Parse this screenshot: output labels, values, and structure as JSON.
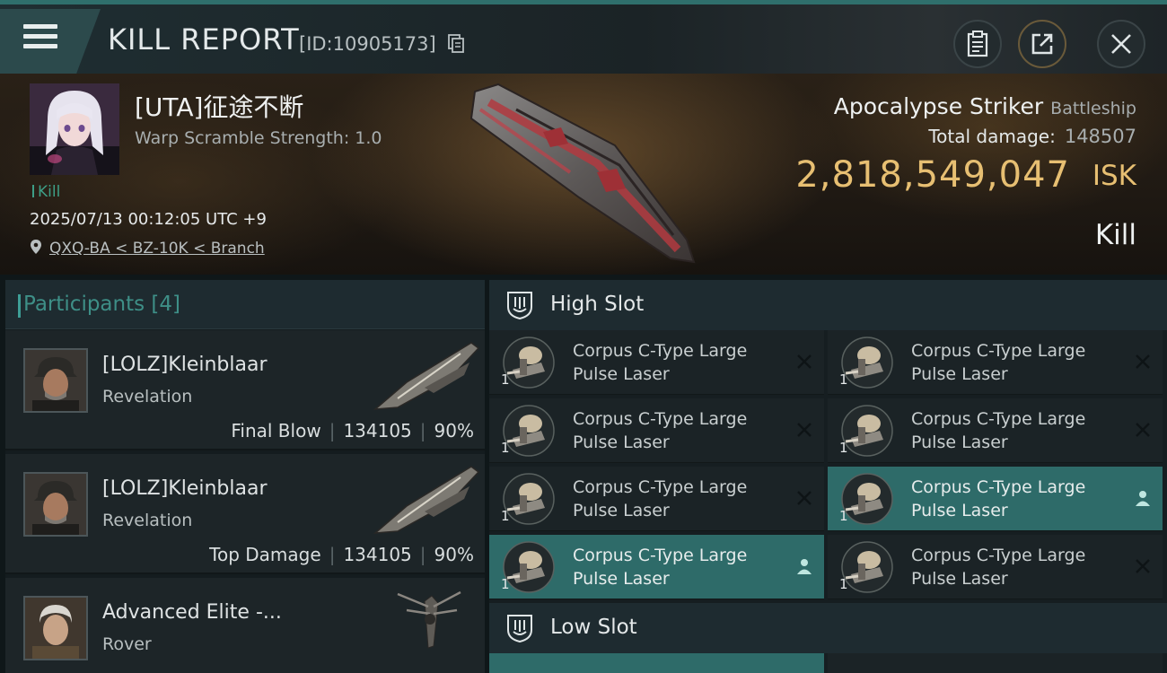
{
  "header": {
    "title": "KILL REPORT",
    "report_id": "[ID:10905173]",
    "icons": [
      "menu-icon",
      "copy-icon",
      "clipboard-icon",
      "share-icon",
      "close-icon"
    ]
  },
  "victim": {
    "name": "[UTA]征途不断",
    "warp_scramble": "Warp Scramble Strength: 1.0",
    "kill_tag": "Kill",
    "time": "2025/07/13 00:12:05 UTC +9",
    "location": "QXQ-BA < BZ-10K < Branch",
    "ship_name": "Apocalypse Striker",
    "ship_class": "Battleship",
    "total_damage_label": "Total damage:",
    "total_damage": "148507",
    "isk_value": "2,818,549,047",
    "isk_unit": "ISK",
    "result": "Kill"
  },
  "participants": {
    "title": "Participants [4]",
    "items": [
      {
        "name": "[LOLZ]Kleinblaar",
        "ship": "Revelation",
        "role": "Final Blow",
        "damage": "134105",
        "percent": "90%"
      },
      {
        "name": "[LOLZ]Kleinblaar",
        "ship": "Revelation",
        "role": "Top Damage",
        "damage": "134105",
        "percent": "90%"
      },
      {
        "name": "Advanced Elite -...",
        "ship": "Rover",
        "role": "",
        "damage": "",
        "percent": ""
      }
    ]
  },
  "slots": {
    "high": {
      "label": "High Slot",
      "modules": [
        {
          "name": "Corpus C-Type Large Pulse Laser",
          "qty": "1",
          "status": "destroyed"
        },
        {
          "name": "Corpus C-Type Large Pulse Laser",
          "qty": "1",
          "status": "destroyed"
        },
        {
          "name": "Corpus C-Type Large Pulse Laser",
          "qty": "1",
          "status": "destroyed"
        },
        {
          "name": "Corpus C-Type Large Pulse Laser",
          "qty": "1",
          "status": "destroyed"
        },
        {
          "name": "Corpus C-Type Large Pulse Laser",
          "qty": "1",
          "status": "destroyed"
        },
        {
          "name": "Corpus C-Type Large Pulse Laser",
          "qty": "1",
          "status": "dropped"
        },
        {
          "name": "Corpus C-Type Large Pulse Laser",
          "qty": "1",
          "status": "dropped"
        },
        {
          "name": "Corpus C-Type Large Pulse Laser",
          "qty": "1",
          "status": "destroyed"
        }
      ]
    },
    "low": {
      "label": "Low Slot"
    }
  },
  "colors": {
    "accent_teal": "#2e6b69",
    "isk_gold": "#e7bf72",
    "kill_green": "#3d9e86"
  }
}
